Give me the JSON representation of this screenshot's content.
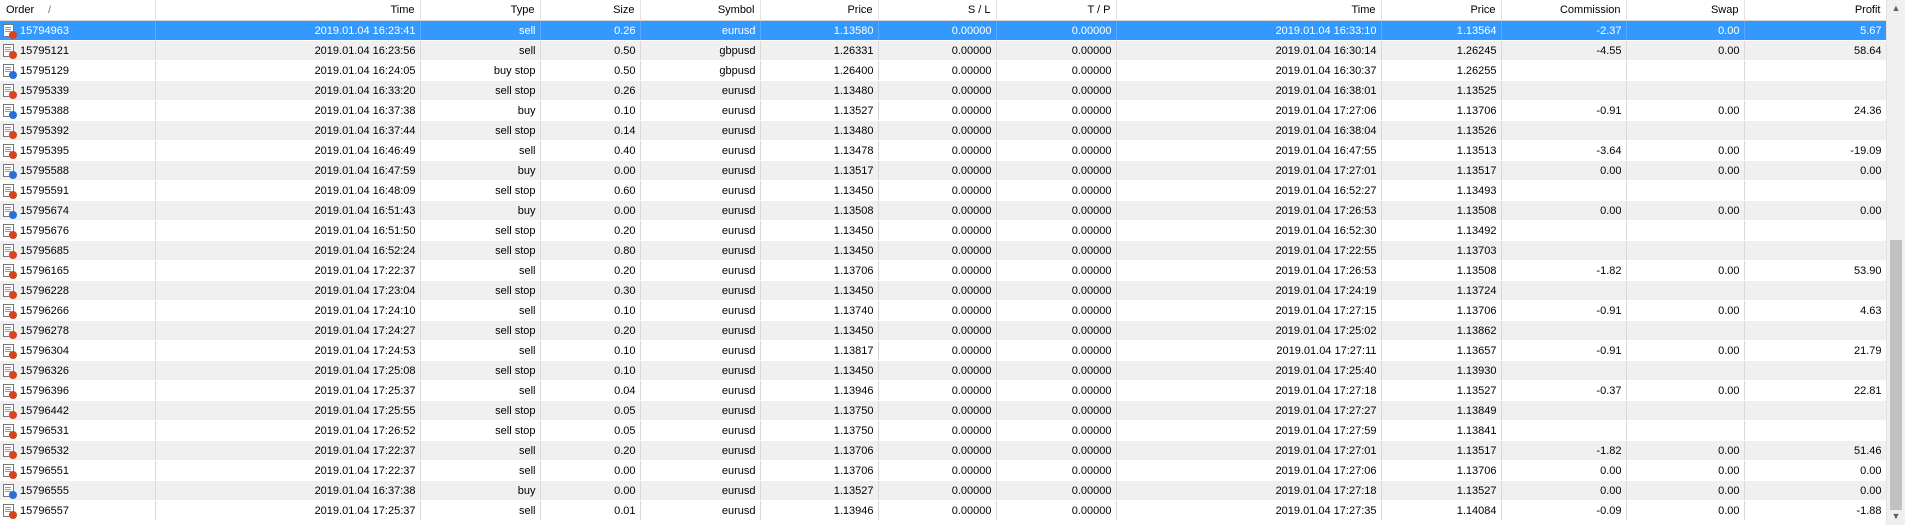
{
  "columns": [
    "Order",
    "Time",
    "Type",
    "Size",
    "Symbol",
    "Price",
    "S / L",
    "T / P",
    "Time",
    "Price",
    "Commission",
    "Swap",
    "Profit"
  ],
  "sort_indicator": "/",
  "rows": [
    {
      "order": "15794963",
      "open_time": "2019.01.04 16:23:41",
      "type": "sell",
      "size": "0.26",
      "symbol": "eurusd",
      "open_price": "1.13580",
      "sl": "0.00000",
      "tp": "0.00000",
      "close_time": "2019.01.04 16:33:10",
      "close_price": "1.13564",
      "commission": "-2.37",
      "swap": "0.00",
      "profit": "5.67",
      "icon": "sell-order-icon",
      "selected": true
    },
    {
      "order": "15795121",
      "open_time": "2019.01.04 16:23:56",
      "type": "sell",
      "size": "0.50",
      "symbol": "gbpusd",
      "open_price": "1.26331",
      "sl": "0.00000",
      "tp": "0.00000",
      "close_time": "2019.01.04 16:30:14",
      "close_price": "1.26245",
      "commission": "-4.55",
      "swap": "0.00",
      "profit": "58.64",
      "icon": "sell-order-icon"
    },
    {
      "order": "15795129",
      "open_time": "2019.01.04 16:24:05",
      "type": "buy stop",
      "size": "0.50",
      "symbol": "gbpusd",
      "open_price": "1.26400",
      "sl": "0.00000",
      "tp": "0.00000",
      "close_time": "2019.01.04 16:30:37",
      "close_price": "1.26255",
      "commission": "",
      "swap": "",
      "profit": "",
      "icon": "buy-order-icon"
    },
    {
      "order": "15795339",
      "open_time": "2019.01.04 16:33:20",
      "type": "sell stop",
      "size": "0.26",
      "symbol": "eurusd",
      "open_price": "1.13480",
      "sl": "0.00000",
      "tp": "0.00000",
      "close_time": "2019.01.04 16:38:01",
      "close_price": "1.13525",
      "commission": "",
      "swap": "",
      "profit": "",
      "icon": "sell-order-icon"
    },
    {
      "order": "15795388",
      "open_time": "2019.01.04 16:37:38",
      "type": "buy",
      "size": "0.10",
      "symbol": "eurusd",
      "open_price": "1.13527",
      "sl": "0.00000",
      "tp": "0.00000",
      "close_time": "2019.01.04 17:27:06",
      "close_price": "1.13706",
      "commission": "-0.91",
      "swap": "0.00",
      "profit": "24.36",
      "icon": "buy-order-icon"
    },
    {
      "order": "15795392",
      "open_time": "2019.01.04 16:37:44",
      "type": "sell stop",
      "size": "0.14",
      "symbol": "eurusd",
      "open_price": "1.13480",
      "sl": "0.00000",
      "tp": "0.00000",
      "close_time": "2019.01.04 16:38:04",
      "close_price": "1.13526",
      "commission": "",
      "swap": "",
      "profit": "",
      "icon": "sell-order-icon"
    },
    {
      "order": "15795395",
      "open_time": "2019.01.04 16:46:49",
      "type": "sell",
      "size": "0.40",
      "symbol": "eurusd",
      "open_price": "1.13478",
      "sl": "0.00000",
      "tp": "0.00000",
      "close_time": "2019.01.04 16:47:55",
      "close_price": "1.13513",
      "commission": "-3.64",
      "swap": "0.00",
      "profit": "-19.09",
      "icon": "sell-order-icon"
    },
    {
      "order": "15795588",
      "open_time": "2019.01.04 16:47:59",
      "type": "buy",
      "size": "0.00",
      "symbol": "eurusd",
      "open_price": "1.13517",
      "sl": "0.00000",
      "tp": "0.00000",
      "close_time": "2019.01.04 17:27:01",
      "close_price": "1.13517",
      "commission": "0.00",
      "swap": "0.00",
      "profit": "0.00",
      "icon": "buy-order-icon"
    },
    {
      "order": "15795591",
      "open_time": "2019.01.04 16:48:09",
      "type": "sell stop",
      "size": "0.60",
      "symbol": "eurusd",
      "open_price": "1.13450",
      "sl": "0.00000",
      "tp": "0.00000",
      "close_time": "2019.01.04 16:52:27",
      "close_price": "1.13493",
      "commission": "",
      "swap": "",
      "profit": "",
      "icon": "sell-order-icon"
    },
    {
      "order": "15795674",
      "open_time": "2019.01.04 16:51:43",
      "type": "buy",
      "size": "0.00",
      "symbol": "eurusd",
      "open_price": "1.13508",
      "sl": "0.00000",
      "tp": "0.00000",
      "close_time": "2019.01.04 17:26:53",
      "close_price": "1.13508",
      "commission": "0.00",
      "swap": "0.00",
      "profit": "0.00",
      "icon": "buy-order-icon"
    },
    {
      "order": "15795676",
      "open_time": "2019.01.04 16:51:50",
      "type": "sell stop",
      "size": "0.20",
      "symbol": "eurusd",
      "open_price": "1.13450",
      "sl": "0.00000",
      "tp": "0.00000",
      "close_time": "2019.01.04 16:52:30",
      "close_price": "1.13492",
      "commission": "",
      "swap": "",
      "profit": "",
      "icon": "sell-order-icon"
    },
    {
      "order": "15795685",
      "open_time": "2019.01.04 16:52:24",
      "type": "sell stop",
      "size": "0.80",
      "symbol": "eurusd",
      "open_price": "1.13450",
      "sl": "0.00000",
      "tp": "0.00000",
      "close_time": "2019.01.04 17:22:55",
      "close_price": "1.13703",
      "commission": "",
      "swap": "",
      "profit": "",
      "icon": "sell-order-icon"
    },
    {
      "order": "15796165",
      "open_time": "2019.01.04 17:22:37",
      "type": "sell",
      "size": "0.20",
      "symbol": "eurusd",
      "open_price": "1.13706",
      "sl": "0.00000",
      "tp": "0.00000",
      "close_time": "2019.01.04 17:26:53",
      "close_price": "1.13508",
      "commission": "-1.82",
      "swap": "0.00",
      "profit": "53.90",
      "icon": "sell-order-icon"
    },
    {
      "order": "15796228",
      "open_time": "2019.01.04 17:23:04",
      "type": "sell stop",
      "size": "0.30",
      "symbol": "eurusd",
      "open_price": "1.13450",
      "sl": "0.00000",
      "tp": "0.00000",
      "close_time": "2019.01.04 17:24:19",
      "close_price": "1.13724",
      "commission": "",
      "swap": "",
      "profit": "",
      "icon": "sell-order-icon"
    },
    {
      "order": "15796266",
      "open_time": "2019.01.04 17:24:10",
      "type": "sell",
      "size": "0.10",
      "symbol": "eurusd",
      "open_price": "1.13740",
      "sl": "0.00000",
      "tp": "0.00000",
      "close_time": "2019.01.04 17:27:15",
      "close_price": "1.13706",
      "commission": "-0.91",
      "swap": "0.00",
      "profit": "4.63",
      "icon": "sell-order-icon"
    },
    {
      "order": "15796278",
      "open_time": "2019.01.04 17:24:27",
      "type": "sell stop",
      "size": "0.20",
      "symbol": "eurusd",
      "open_price": "1.13450",
      "sl": "0.00000",
      "tp": "0.00000",
      "close_time": "2019.01.04 17:25:02",
      "close_price": "1.13862",
      "commission": "",
      "swap": "",
      "profit": "",
      "icon": "sell-order-icon"
    },
    {
      "order": "15796304",
      "open_time": "2019.01.04 17:24:53",
      "type": "sell",
      "size": "0.10",
      "symbol": "eurusd",
      "open_price": "1.13817",
      "sl": "0.00000",
      "tp": "0.00000",
      "close_time": "2019.01.04 17:27:11",
      "close_price": "1.13657",
      "commission": "-0.91",
      "swap": "0.00",
      "profit": "21.79",
      "icon": "sell-order-icon"
    },
    {
      "order": "15796326",
      "open_time": "2019.01.04 17:25:08",
      "type": "sell stop",
      "size": "0.10",
      "symbol": "eurusd",
      "open_price": "1.13450",
      "sl": "0.00000",
      "tp": "0.00000",
      "close_time": "2019.01.04 17:25:40",
      "close_price": "1.13930",
      "commission": "",
      "swap": "",
      "profit": "",
      "icon": "sell-order-icon"
    },
    {
      "order": "15796396",
      "open_time": "2019.01.04 17:25:37",
      "type": "sell",
      "size": "0.04",
      "symbol": "eurusd",
      "open_price": "1.13946",
      "sl": "0.00000",
      "tp": "0.00000",
      "close_time": "2019.01.04 17:27:18",
      "close_price": "1.13527",
      "commission": "-0.37",
      "swap": "0.00",
      "profit": "22.81",
      "icon": "sell-order-icon"
    },
    {
      "order": "15796442",
      "open_time": "2019.01.04 17:25:55",
      "type": "sell stop",
      "size": "0.05",
      "symbol": "eurusd",
      "open_price": "1.13750",
      "sl": "0.00000",
      "tp": "0.00000",
      "close_time": "2019.01.04 17:27:27",
      "close_price": "1.13849",
      "commission": "",
      "swap": "",
      "profit": "",
      "icon": "sell-order-icon"
    },
    {
      "order": "15796531",
      "open_time": "2019.01.04 17:26:52",
      "type": "sell stop",
      "size": "0.05",
      "symbol": "eurusd",
      "open_price": "1.13750",
      "sl": "0.00000",
      "tp": "0.00000",
      "close_time": "2019.01.04 17:27:59",
      "close_price": "1.13841",
      "commission": "",
      "swap": "",
      "profit": "",
      "icon": "sell-order-icon"
    },
    {
      "order": "15796532",
      "open_time": "2019.01.04 17:22:37",
      "type": "sell",
      "size": "0.20",
      "symbol": "eurusd",
      "open_price": "1.13706",
      "sl": "0.00000",
      "tp": "0.00000",
      "close_time": "2019.01.04 17:27:01",
      "close_price": "1.13517",
      "commission": "-1.82",
      "swap": "0.00",
      "profit": "51.46",
      "icon": "sell-order-icon"
    },
    {
      "order": "15796551",
      "open_time": "2019.01.04 17:22:37",
      "type": "sell",
      "size": "0.00",
      "symbol": "eurusd",
      "open_price": "1.13706",
      "sl": "0.00000",
      "tp": "0.00000",
      "close_time": "2019.01.04 17:27:06",
      "close_price": "1.13706",
      "commission": "0.00",
      "swap": "0.00",
      "profit": "0.00",
      "icon": "sell-order-icon"
    },
    {
      "order": "15796555",
      "open_time": "2019.01.04 16:37:38",
      "type": "buy",
      "size": "0.00",
      "symbol": "eurusd",
      "open_price": "1.13527",
      "sl": "0.00000",
      "tp": "0.00000",
      "close_time": "2019.01.04 17:27:18",
      "close_price": "1.13527",
      "commission": "0.00",
      "swap": "0.00",
      "profit": "0.00",
      "icon": "buy-order-icon"
    },
    {
      "order": "15796557",
      "open_time": "2019.01.04 17:25:37",
      "type": "sell",
      "size": "0.01",
      "symbol": "eurusd",
      "open_price": "1.13946",
      "sl": "0.00000",
      "tp": "0.00000",
      "close_time": "2019.01.04 17:27:35",
      "close_price": "1.14084",
      "commission": "-0.09",
      "swap": "0.00",
      "profit": "-1.88",
      "icon": "sell-order-icon"
    }
  ],
  "scrollbar": {
    "up_icon": "scroll-up-arrow-icon",
    "down_icon": "scroll-down-arrow-icon"
  }
}
